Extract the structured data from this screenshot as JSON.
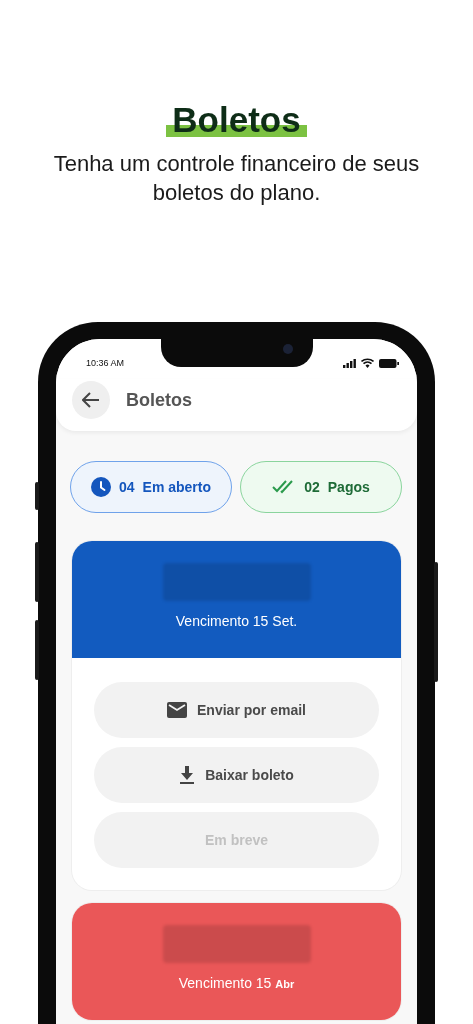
{
  "headline": {
    "title": "Boletos",
    "subtitle": "Tenha um controle financeiro de seus boletos do plano."
  },
  "status_bar": {
    "time": "10:36 AM"
  },
  "header": {
    "title": "Boletos"
  },
  "filters": [
    {
      "kind": "open",
      "count": "04",
      "label": "Em aberto"
    },
    {
      "kind": "paid",
      "count": "02",
      "label": "Pagos"
    }
  ],
  "boletos": [
    {
      "color": "#125bbf",
      "due": "Vencimento 15 Set.",
      "actions": [
        {
          "kind": "email",
          "label": "Enviar por email",
          "disabled": false
        },
        {
          "kind": "download",
          "label": "Baixar boleto",
          "disabled": false
        },
        {
          "kind": "plain",
          "label": "Em breve",
          "disabled": true
        }
      ]
    },
    {
      "color": "#ea5758",
      "due": "Vencimento 15",
      "due_small": "Abr"
    }
  ]
}
